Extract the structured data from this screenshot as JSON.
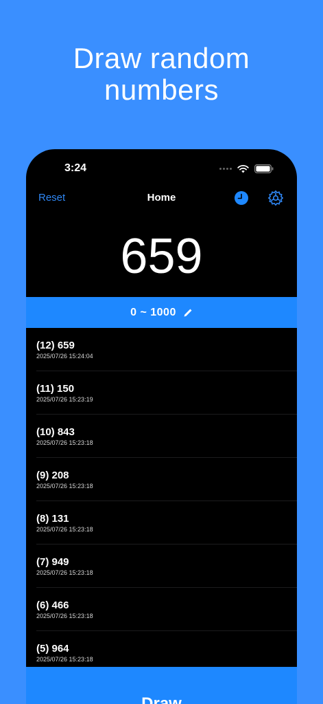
{
  "headline": {
    "line1": "Draw random",
    "line2": "numbers"
  },
  "status_bar": {
    "time": "3:24"
  },
  "nav": {
    "reset_label": "Reset",
    "title": "Home"
  },
  "current_number": "659",
  "range": {
    "label": "0 ~ 1000"
  },
  "history": [
    {
      "label": "(12) 659",
      "time": "2025/07/26 15:24:04"
    },
    {
      "label": "(11) 150",
      "time": "2025/07/26 15:23:19"
    },
    {
      "label": "(10) 843",
      "time": "2025/07/26 15:23:18"
    },
    {
      "label": "(9) 208",
      "time": "2025/07/26 15:23:18"
    },
    {
      "label": "(8) 131",
      "time": "2025/07/26 15:23:18"
    },
    {
      "label": "(7) 949",
      "time": "2025/07/26 15:23:18"
    },
    {
      "label": "(6) 466",
      "time": "2025/07/26 15:23:18"
    },
    {
      "label": "(5) 964",
      "time": "2025/07/26 15:23:18"
    }
  ],
  "draw_button": {
    "label": "Draw"
  },
  "colors": {
    "background": "#3A8FFF",
    "accent": "#1E88FF",
    "link": "#2F87F5",
    "surface": "#000000"
  },
  "icons": {
    "history": "clock-icon",
    "settings": "gear-icon",
    "range_edit": "pencil-icon",
    "wifi": "wifi-icon",
    "battery": "battery-icon"
  }
}
